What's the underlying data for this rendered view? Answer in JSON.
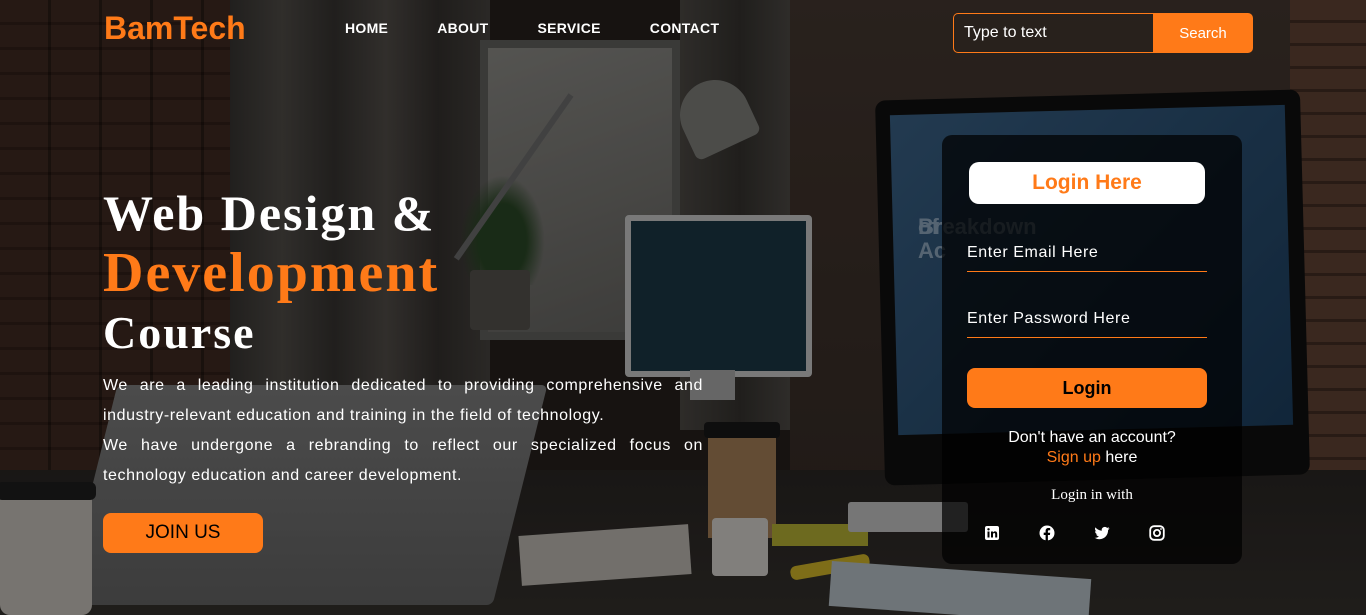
{
  "header": {
    "logo": "BamTech",
    "nav": [
      "HOME",
      "ABOUT",
      "SERVICE",
      "CONTACT"
    ],
    "search": {
      "placeholder": "Type to text",
      "button": "Search"
    }
  },
  "hero": {
    "title_line1": "Web Design &",
    "title_line2": "Development",
    "title_line3": "Course",
    "paragraph1": "We are a leading institution dedicated to providing comprehensive and industry-relevant education and training in the field of technology.",
    "paragraph2": "We have undergone a rebranding to reflect our specialized focus on technology education and career development.",
    "cta": "JOIN US"
  },
  "login": {
    "title": "Login Here",
    "email_placeholder": "Enter Email Here",
    "password_placeholder": "Enter Password Here",
    "button": "Login",
    "no_account": "Don't have an account?",
    "signup_link": "Sign up",
    "signup_suffix": " here",
    "login_with": "Login in with",
    "socials": [
      "linkedin-icon",
      "facebook-icon",
      "twitter-icon",
      "instagram-icon"
    ]
  },
  "background_screen": {
    "line1": "Breakdown",
    "line2": "of Ac"
  },
  "colors": {
    "accent": "#ff7a18",
    "card": "#000000",
    "text": "#ffffff"
  }
}
